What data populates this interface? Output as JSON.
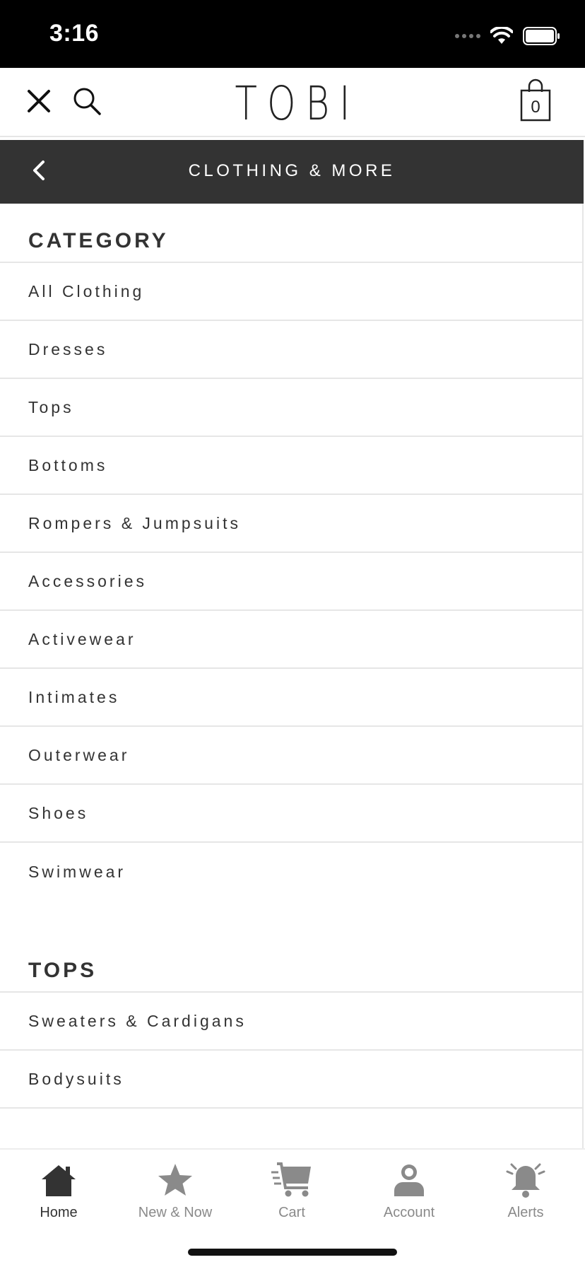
{
  "status_bar": {
    "time": "3:16"
  },
  "header": {
    "logo": "TOBI",
    "bag_count": "0"
  },
  "subbar": {
    "title": "CLOTHING & MORE"
  },
  "sections": {
    "category": {
      "title": "CATEGORY",
      "items": [
        "All Clothing",
        "Dresses",
        "Tops",
        "Bottoms",
        "Rompers & Jumpsuits",
        "Accessories",
        "Activewear",
        "Intimates",
        "Outerwear",
        "Shoes",
        "Swimwear"
      ]
    },
    "tops": {
      "title": "TOPS",
      "items": [
        "Sweaters & Cardigans",
        "Bodysuits"
      ]
    }
  },
  "tabbar": {
    "tabs": [
      {
        "label": "Home",
        "icon": "home-icon",
        "active": true
      },
      {
        "label": "New & Now",
        "icon": "star-icon",
        "active": false
      },
      {
        "label": "Cart",
        "icon": "cart-icon",
        "active": false
      },
      {
        "label": "Account",
        "icon": "account-icon",
        "active": false
      },
      {
        "label": "Alerts",
        "icon": "bell-icon",
        "active": false
      }
    ]
  },
  "colors": {
    "status_bar_bg": "#000000",
    "subbar_bg": "#333333",
    "text": "#333333",
    "inactive_tab": "#8a8a8a",
    "divider": "#e6e6e6"
  }
}
